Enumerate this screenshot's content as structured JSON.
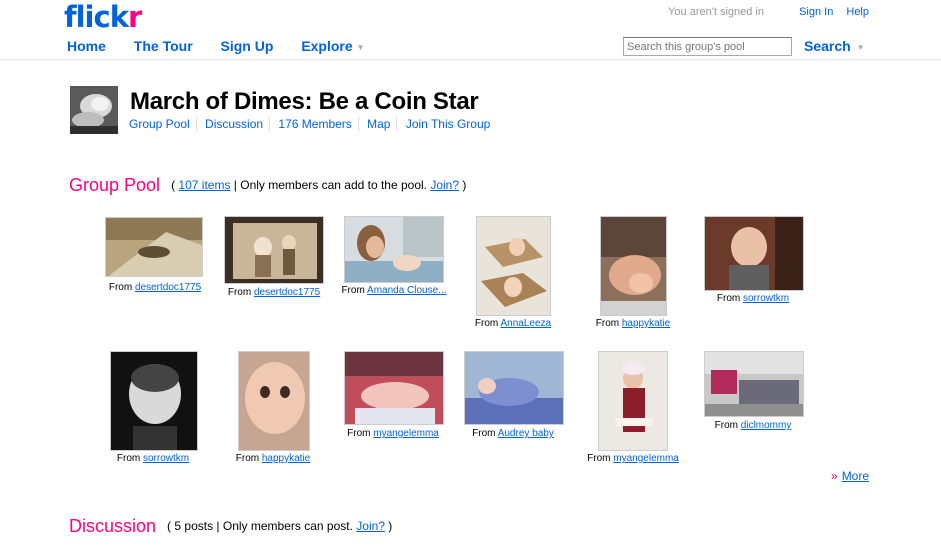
{
  "header": {
    "logo_main": "flick",
    "logo_accent": "r",
    "signin_status": "You aren't signed in",
    "signin_link": "Sign In",
    "help_link": "Help"
  },
  "nav": {
    "items": [
      "Home",
      "The Tour",
      "Sign Up",
      "Explore"
    ],
    "search_placeholder": "Search this group's pool",
    "search_button": "Search"
  },
  "group": {
    "title": "March of Dimes: Be a Coin Star",
    "links": [
      "Group Pool",
      "Discussion",
      "176 Members",
      "Map",
      "Join This Group"
    ]
  },
  "pool": {
    "heading": "Group Pool",
    "open_paren": "(",
    "count_link": "107 items",
    "note": " |  Only members can add to the pool. ",
    "join_link": "Join?",
    "close_paren": " )",
    "from_label": "From",
    "photos": [
      {
        "user": "desertdoc1775"
      },
      {
        "user": "desertdoc1775"
      },
      {
        "user": "Amanda Clouse..."
      },
      {
        "user": "AnnaLeeza"
      },
      {
        "user": "happykatie"
      },
      {
        "user": "sorrowtkm"
      },
      {
        "user": "sorrowtkm"
      },
      {
        "user": "happykatie"
      },
      {
        "user": "myangelemma"
      },
      {
        "user": "Audrey baby"
      },
      {
        "user": "myangelemma"
      },
      {
        "user": "diclmommy"
      }
    ],
    "more_arrows": "»",
    "more_link": "More"
  },
  "discussion": {
    "heading": "Discussion",
    "open_paren": "(",
    "count": "5 posts",
    "note": "  |  Only members can post. ",
    "join_link": "Join?",
    "close_paren": " )"
  }
}
